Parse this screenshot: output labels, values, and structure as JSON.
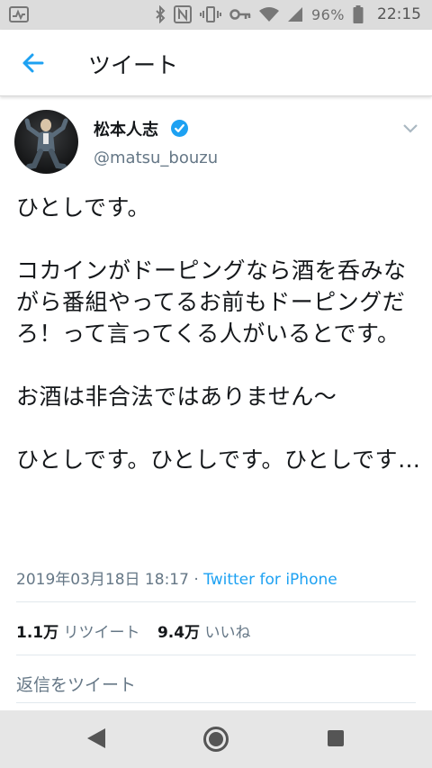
{
  "status_bar": {
    "battery_percent": "96%",
    "time": "22:15",
    "icons": [
      "activity-icon",
      "bluetooth-icon",
      "nfc-icon",
      "vibrate-icon",
      "key-icon",
      "wifi-icon",
      "signal-icon",
      "battery-icon"
    ]
  },
  "header": {
    "back_icon": "arrow-left-icon",
    "title": "ツイート"
  },
  "tweet": {
    "author_name": "松本人志",
    "verified": true,
    "handle": "@matsu_bouzu",
    "text": "ひとしです。\n\nコカインがドーピングなら酒を呑みながら番組やってるお前もドーピングだろ！って言ってくる人がいるとです。\n\nお酒は非合法ではありません〜\n\nひとしです。ひとしです。ひとしです…",
    "timestamp": "2019年03月18日 18:17",
    "separator": " · ",
    "source": "Twitter for iPhone",
    "retweets_count": "1.1万",
    "retweets_label": "リツイート",
    "likes_count": "9.4万",
    "likes_label": "いいね"
  },
  "reply": {
    "placeholder": "返信をツイート"
  },
  "colors": {
    "accent": "#1da1f2",
    "secondary_text": "#657786",
    "primary_text": "#14171a"
  }
}
